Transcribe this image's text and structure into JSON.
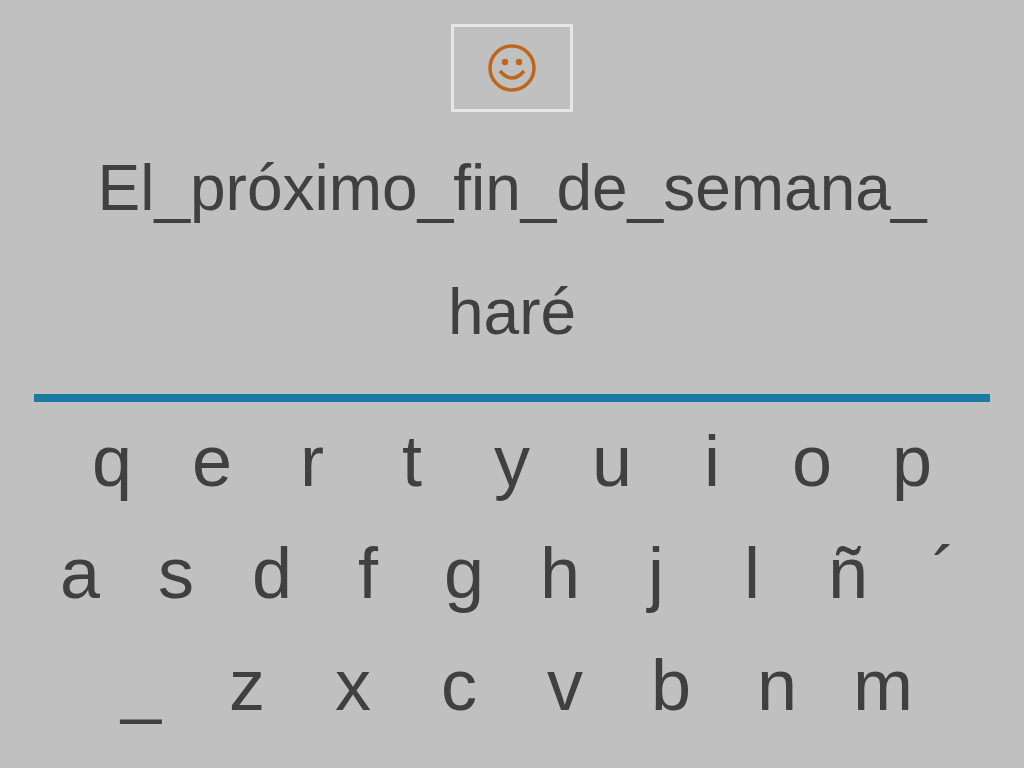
{
  "sentence": {
    "lines": [
      "El_próximo_fin_de_semana_",
      "haré"
    ]
  },
  "keyboard": {
    "rows": [
      [
        "q",
        "e",
        "r",
        "t",
        "y",
        "u",
        "i",
        "o",
        "p"
      ],
      [
        "a",
        "s",
        "d",
        "f",
        "g",
        "h",
        "j",
        "l",
        "ñ",
        "´"
      ],
      [
        "_",
        "z",
        "x",
        "c",
        "v",
        "b",
        "n",
        "m"
      ]
    ]
  }
}
